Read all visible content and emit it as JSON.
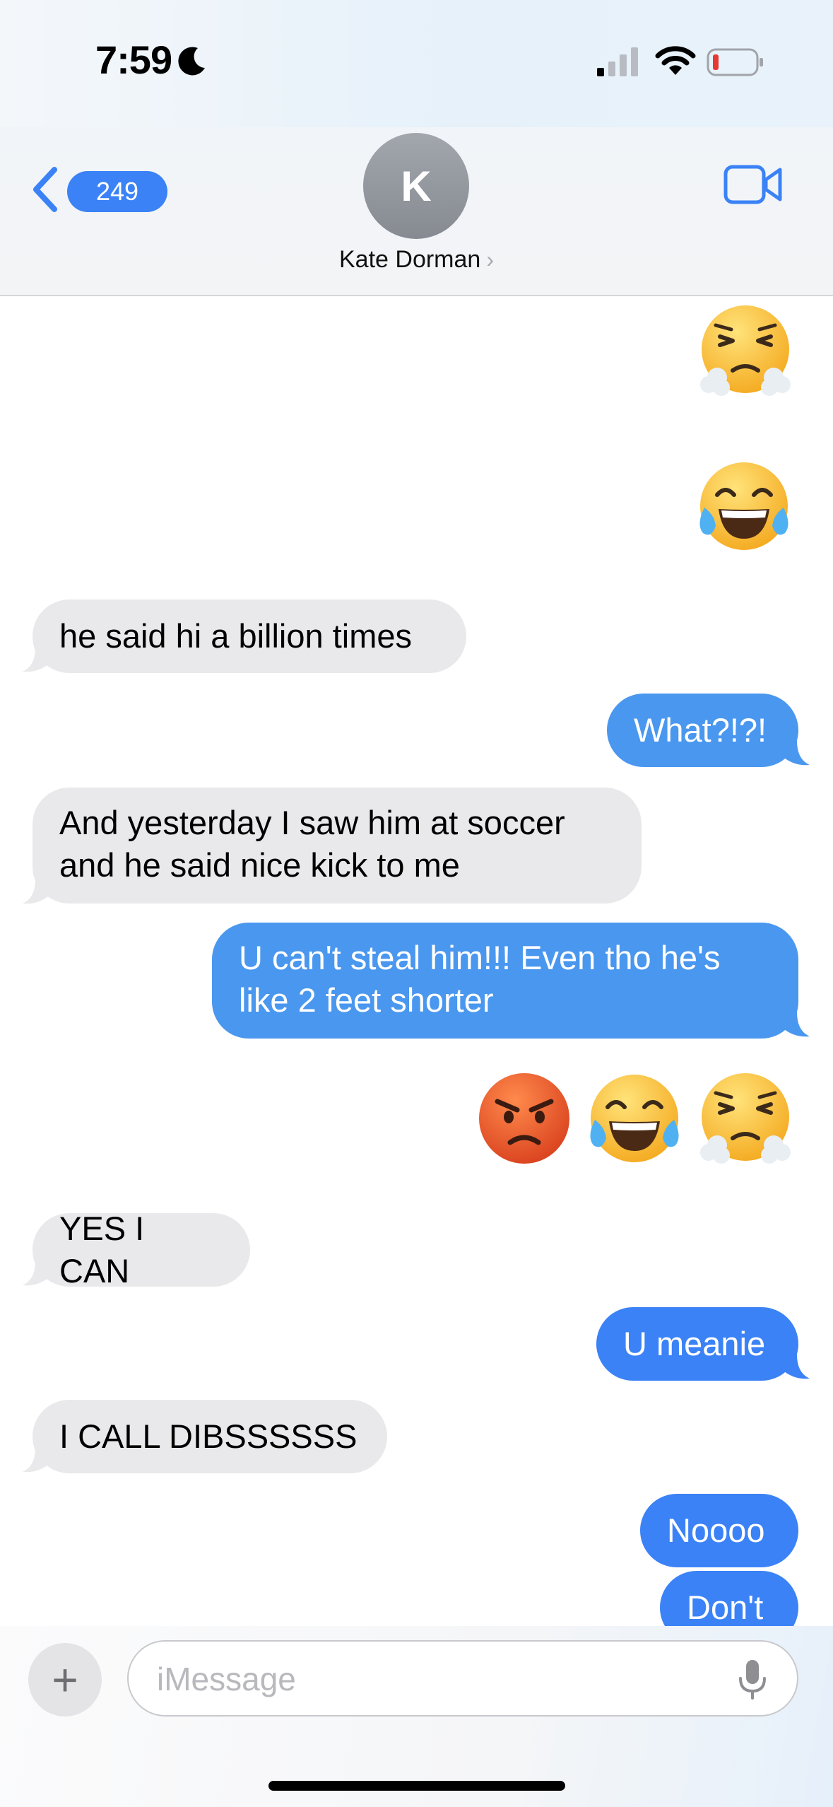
{
  "status_bar": {
    "time": "7:59",
    "focus_icon": "moon-icon",
    "signal_icon": "cellular-signal-icon",
    "wifi_icon": "wifi-icon",
    "battery_icon": "battery-low-icon",
    "battery_color": "#e53935"
  },
  "header": {
    "back_count": "249",
    "avatar_initial": "K",
    "contact_name": "Kate Dorman",
    "contact_chevron": "›",
    "video_icon": "video-call-icon"
  },
  "messages": [
    {
      "side": "out",
      "type": "emoji",
      "content": [
        "😤"
      ]
    },
    {
      "side": "out",
      "type": "emoji",
      "content": [
        "😂"
      ]
    },
    {
      "side": "in",
      "type": "text",
      "text": "he said hi a billion times"
    },
    {
      "side": "out",
      "type": "text",
      "text": "What?!?!"
    },
    {
      "side": "in",
      "type": "text",
      "lines": [
        "And yesterday I saw him at soccer",
        "and he said nice kick to me"
      ]
    },
    {
      "side": "out",
      "type": "text",
      "lines": [
        "U can't steal him!!! Even tho he's",
        "like 2 feet shorter"
      ]
    },
    {
      "side": "out",
      "type": "emoji",
      "content": [
        "😡",
        "😂",
        "😤"
      ]
    },
    {
      "side": "in",
      "type": "text",
      "text": "YES I CAN"
    },
    {
      "side": "out",
      "type": "text",
      "text": "U meanie"
    },
    {
      "side": "in",
      "type": "text",
      "text": "I CALL DIBSSSSSS"
    },
    {
      "side": "out",
      "type": "text",
      "text": "Noooo"
    },
    {
      "side": "out",
      "type": "text",
      "text": "Don't"
    }
  ],
  "colors": {
    "outgoing_bubble": "#3b82f6",
    "incoming_bubble": "#e9e9eb",
    "accent": "#3a82f6"
  },
  "input_bar": {
    "plus_label": "+",
    "placeholder": "iMessage",
    "value": "",
    "mic_icon": "microphone-icon"
  }
}
